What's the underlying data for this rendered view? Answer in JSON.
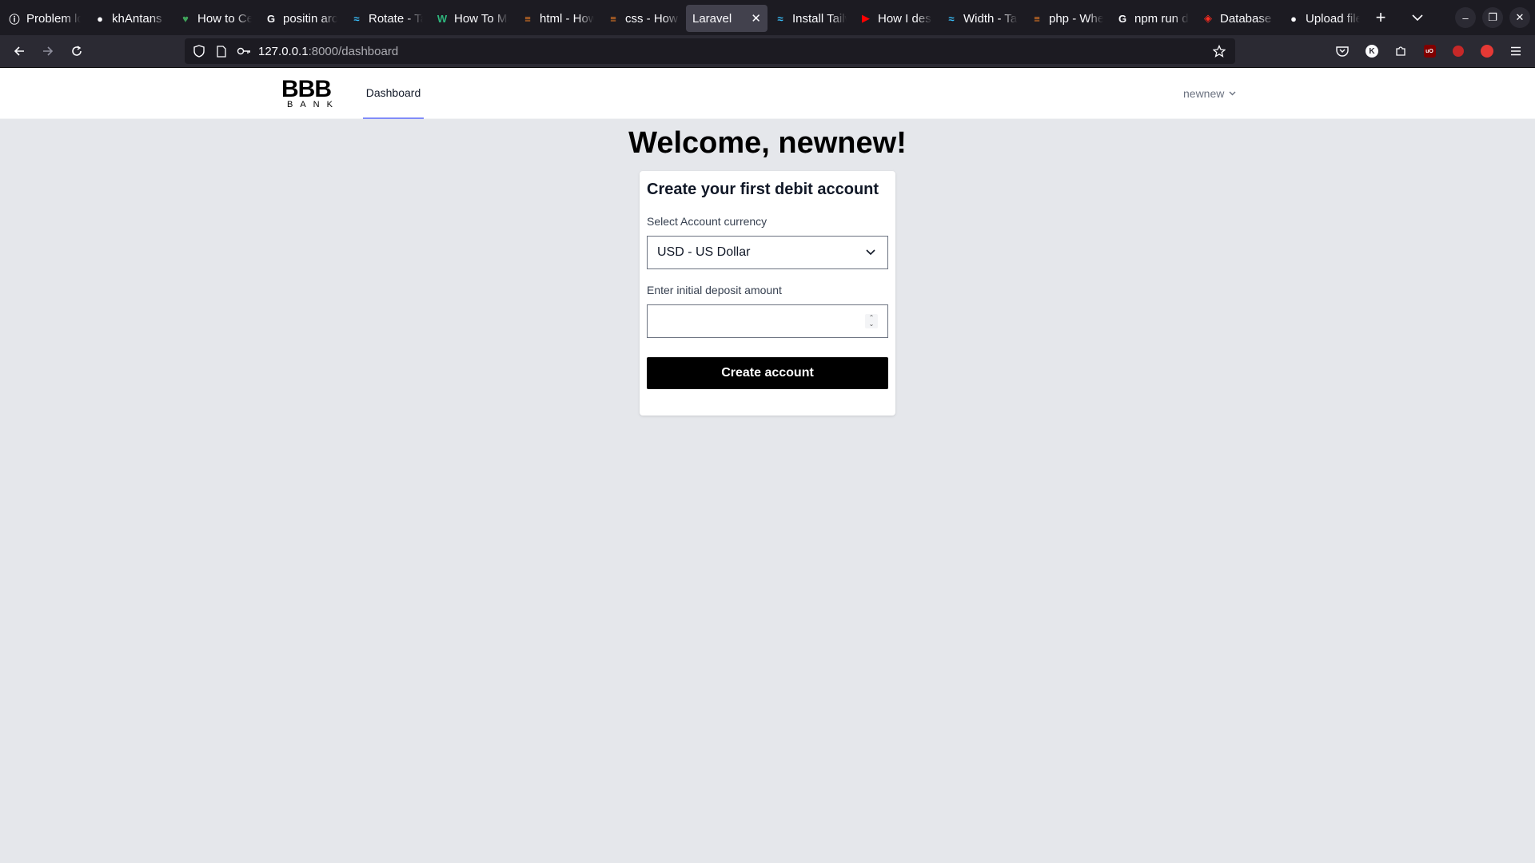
{
  "browser": {
    "tabs": [
      {
        "label": "Problem loading page",
        "icon": "info-icon",
        "active": false
      },
      {
        "label": "khAntans",
        "icon": "github-icon",
        "active": false
      },
      {
        "label": "How to Center",
        "icon": "leaf-icon",
        "active": false
      },
      {
        "label": "positin around",
        "icon": "google-icon",
        "active": false
      },
      {
        "label": "Rotate - Tailwind",
        "icon": "tailwind-icon",
        "active": false
      },
      {
        "label": "How To Make",
        "icon": "w-icon",
        "active": false
      },
      {
        "label": "html - How",
        "icon": "stackoverflow-icon",
        "active": false
      },
      {
        "label": "css - How",
        "icon": "stackoverflow-icon",
        "active": false
      },
      {
        "label": "Laravel",
        "icon": "none",
        "active": true
      },
      {
        "label": "Install Tailwind",
        "icon": "tailwind-icon",
        "active": false
      },
      {
        "label": "How I design",
        "icon": "youtube-icon",
        "active": false
      },
      {
        "label": "Width - Tailwind",
        "icon": "tailwind-icon",
        "active": false
      },
      {
        "label": "php - When",
        "icon": "stackoverflow-icon",
        "active": false
      },
      {
        "label": "npm run dev",
        "icon": "google-icon",
        "active": false
      },
      {
        "label": "Database",
        "icon": "laravel-icon",
        "active": false
      },
      {
        "label": "Upload files",
        "icon": "github-icon",
        "active": false
      }
    ],
    "url_host": "127.0.0.1",
    "url_path": ":8000/dashboard"
  },
  "header": {
    "logo_main": "BBB",
    "logo_sub": "BANK",
    "nav_dashboard": "Dashboard",
    "user_name": "newnew"
  },
  "main": {
    "welcome": "Welcome, newnew!",
    "card_title": "Create your first debit account",
    "currency_label": "Select Account currency",
    "currency_value": "USD - US Dollar",
    "deposit_label": "Enter initial deposit amount",
    "deposit_value": "",
    "submit_label": "Create account"
  },
  "colors": {
    "page_bg": "#e5e7eb",
    "nav_active_underline": "#818cf8",
    "button_bg": "#000000"
  }
}
